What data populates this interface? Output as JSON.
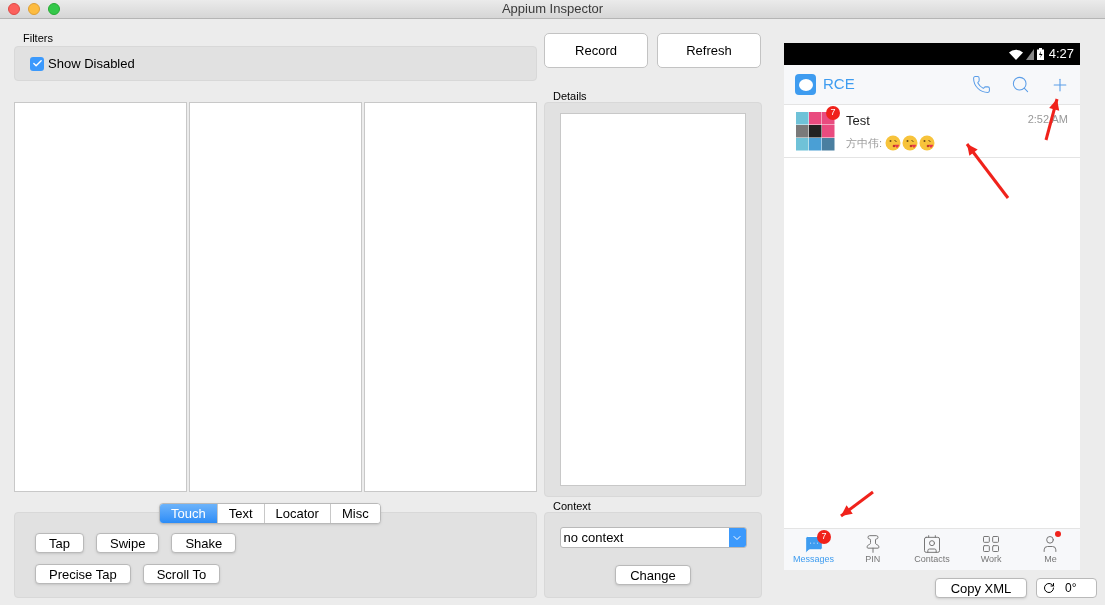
{
  "window": {
    "title": "Appium Inspector"
  },
  "filters": {
    "label": "Filters",
    "show_disabled": {
      "label": "Show Disabled",
      "checked": true
    }
  },
  "buttons": [
    "Record",
    "Refresh"
  ],
  "details": {
    "label": "Details"
  },
  "action_tabs": [
    {
      "label": "Touch",
      "selected": true
    },
    {
      "label": "Text",
      "selected": false
    },
    {
      "label": "Locator",
      "selected": false
    },
    {
      "label": "Misc",
      "selected": false
    }
  ],
  "actions": [
    [
      "Tap",
      "Swipe",
      "Shake"
    ],
    [
      "Precise Tap",
      "Scroll To"
    ]
  ],
  "context": {
    "label": "Context",
    "value": "no context",
    "button": "Change"
  },
  "device": {
    "status_bar": {
      "time": "4:27"
    },
    "app_name": "RCE",
    "conversations": [
      {
        "title": "Test",
        "time": "2:52 AM",
        "unread": "7",
        "preview": "方中伟:"
      }
    ],
    "nav": [
      {
        "label": "Messages",
        "selected": true,
        "badge": "7",
        "dot": false
      },
      {
        "label": "PIN",
        "selected": false,
        "dot": false
      },
      {
        "label": "Contacts",
        "selected": false,
        "dot": false
      },
      {
        "label": "Work",
        "selected": false,
        "dot": false
      },
      {
        "label": "Me",
        "selected": false,
        "dot": true
      }
    ]
  },
  "footer": {
    "copy_button": "Copy XML",
    "rotation": "0°"
  }
}
